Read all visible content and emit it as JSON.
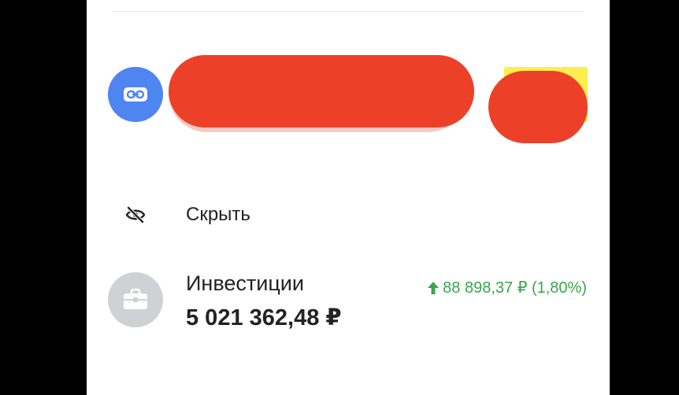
{
  "colors": {
    "link_avatar": "#4e85f1",
    "invest_avatar": "#d0d1d4",
    "positive_change": "#3aa549",
    "redaction": "#ec4128",
    "highlight": "#fcee4e"
  },
  "link_account": {
    "icon": "link-icon"
  },
  "hide_action": {
    "icon": "eye-crossed-icon",
    "label": "Скрыть"
  },
  "investments": {
    "icon": "briefcase-icon",
    "title": "Инвестиции",
    "amount": "5 021 362,48 ₽",
    "change_icon": "arrow-up-icon",
    "change": "88 898,37 ₽ (1,80%)"
  }
}
